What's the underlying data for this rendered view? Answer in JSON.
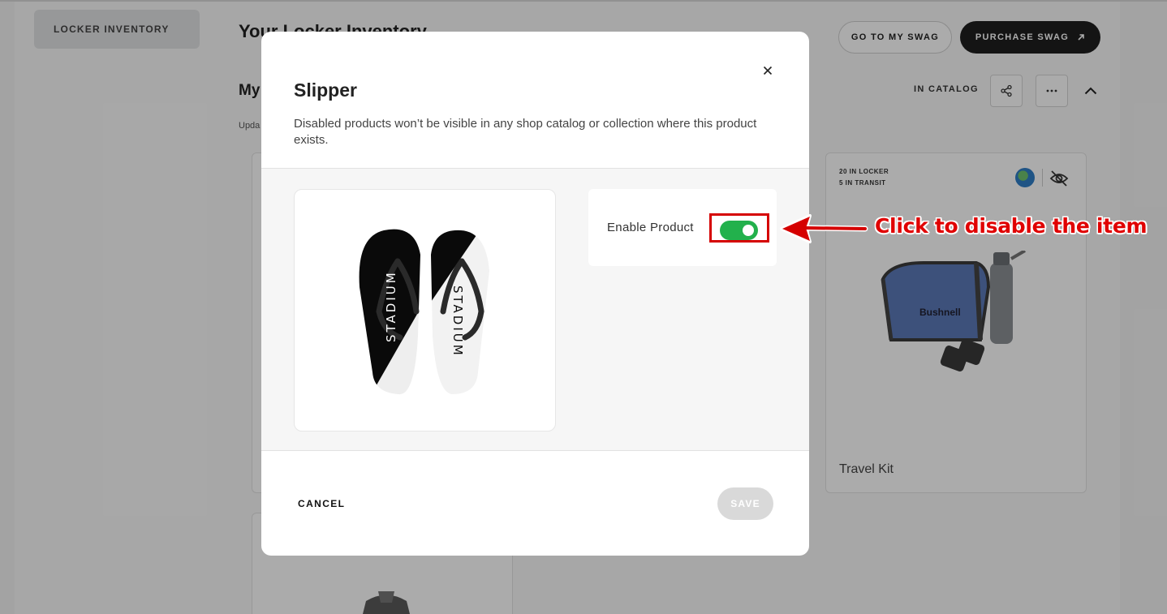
{
  "sidebar": {
    "active_item": "LOCKER INVENTORY"
  },
  "header": {
    "title": "Your Locker Inventory",
    "go_to_swag": "GO TO MY SWAG",
    "purchase_swag": "PURCHASE SWAG"
  },
  "section": {
    "title": "My",
    "updated": "Upda",
    "in_catalog": "IN CATALOG"
  },
  "product_card": {
    "stock_locker": "20 IN LOCKER",
    "stock_transit": "5 IN TRANSIT",
    "name": "Travel Kit",
    "brand": "Bushnell"
  },
  "modal": {
    "title": "Slipper",
    "description": "Disabled products won’t be visible in any shop catalog or collection where this product exists.",
    "enable_label": "Enable Product",
    "enabled": true,
    "cancel": "CANCEL",
    "save": "SAVE",
    "image_text_left": "STADIUM",
    "image_text_right": "STADIUM"
  },
  "annotation": {
    "text": "Click to disable the item",
    "color": "#e00000"
  },
  "colors": {
    "toggle_on": "#22b14c",
    "dark_button": "#1e1e1e"
  }
}
